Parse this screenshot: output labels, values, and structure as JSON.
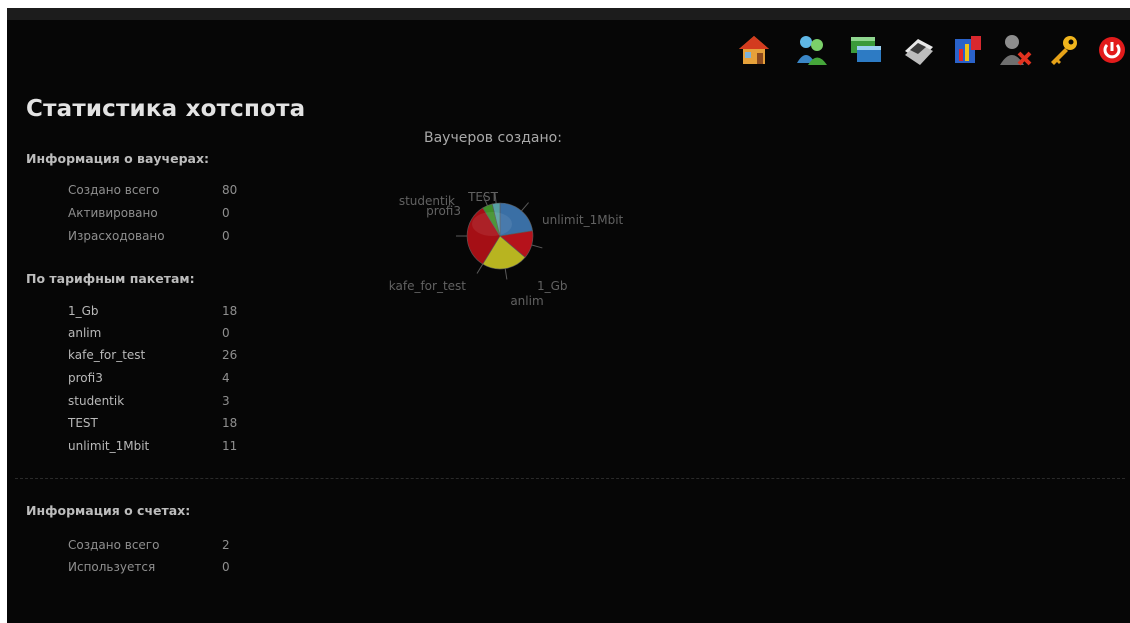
{
  "page": {
    "title": "Статистика хотспота"
  },
  "toolbar": {
    "icons": [
      {
        "name": "home-icon"
      },
      {
        "name": "users-icon"
      },
      {
        "name": "windows-icon"
      },
      {
        "name": "tickets-icon"
      },
      {
        "name": "report-icon"
      },
      {
        "name": "remove-user-icon"
      },
      {
        "name": "key-icon"
      },
      {
        "name": "power-icon"
      }
    ]
  },
  "vouchers": {
    "title": "Информация о ваучерах:",
    "rows": [
      {
        "label": "Создано всего",
        "value": "80"
      },
      {
        "label": "Активировано",
        "value": "0"
      },
      {
        "label": "Израсходовано",
        "value": "0"
      }
    ]
  },
  "packages": {
    "title": "По тарифным пакетам:",
    "rows": [
      {
        "label": "1_Gb",
        "value": "18"
      },
      {
        "label": "anlim",
        "value": "0"
      },
      {
        "label": "kafe_for_test",
        "value": "26"
      },
      {
        "label": "profi3",
        "value": "4"
      },
      {
        "label": "studentik",
        "value": "3"
      },
      {
        "label": "TEST",
        "value": "18"
      },
      {
        "label": "unlimit_1Mbit",
        "value": "11"
      }
    ]
  },
  "accounts": {
    "title": "Информация о счетах:",
    "rows": [
      {
        "label": "Создано всего",
        "value": "2"
      },
      {
        "label": "Используется",
        "value": "0"
      }
    ]
  },
  "chart_data": {
    "type": "pie",
    "title": "Ваучеров создано:",
    "categories": [
      "TEST",
      "unlimit_1Mbit",
      "1_Gb",
      "anlim",
      "kafe_for_test",
      "profi3",
      "studentik"
    ],
    "values": [
      18,
      11,
      18,
      0,
      26,
      4,
      3
    ],
    "colors": [
      "#3a6fa5",
      "#b5121b",
      "#b8b420",
      "#7a6a2c",
      "#a50f15",
      "#3f8f2a",
      "#57a0a3"
    ]
  }
}
